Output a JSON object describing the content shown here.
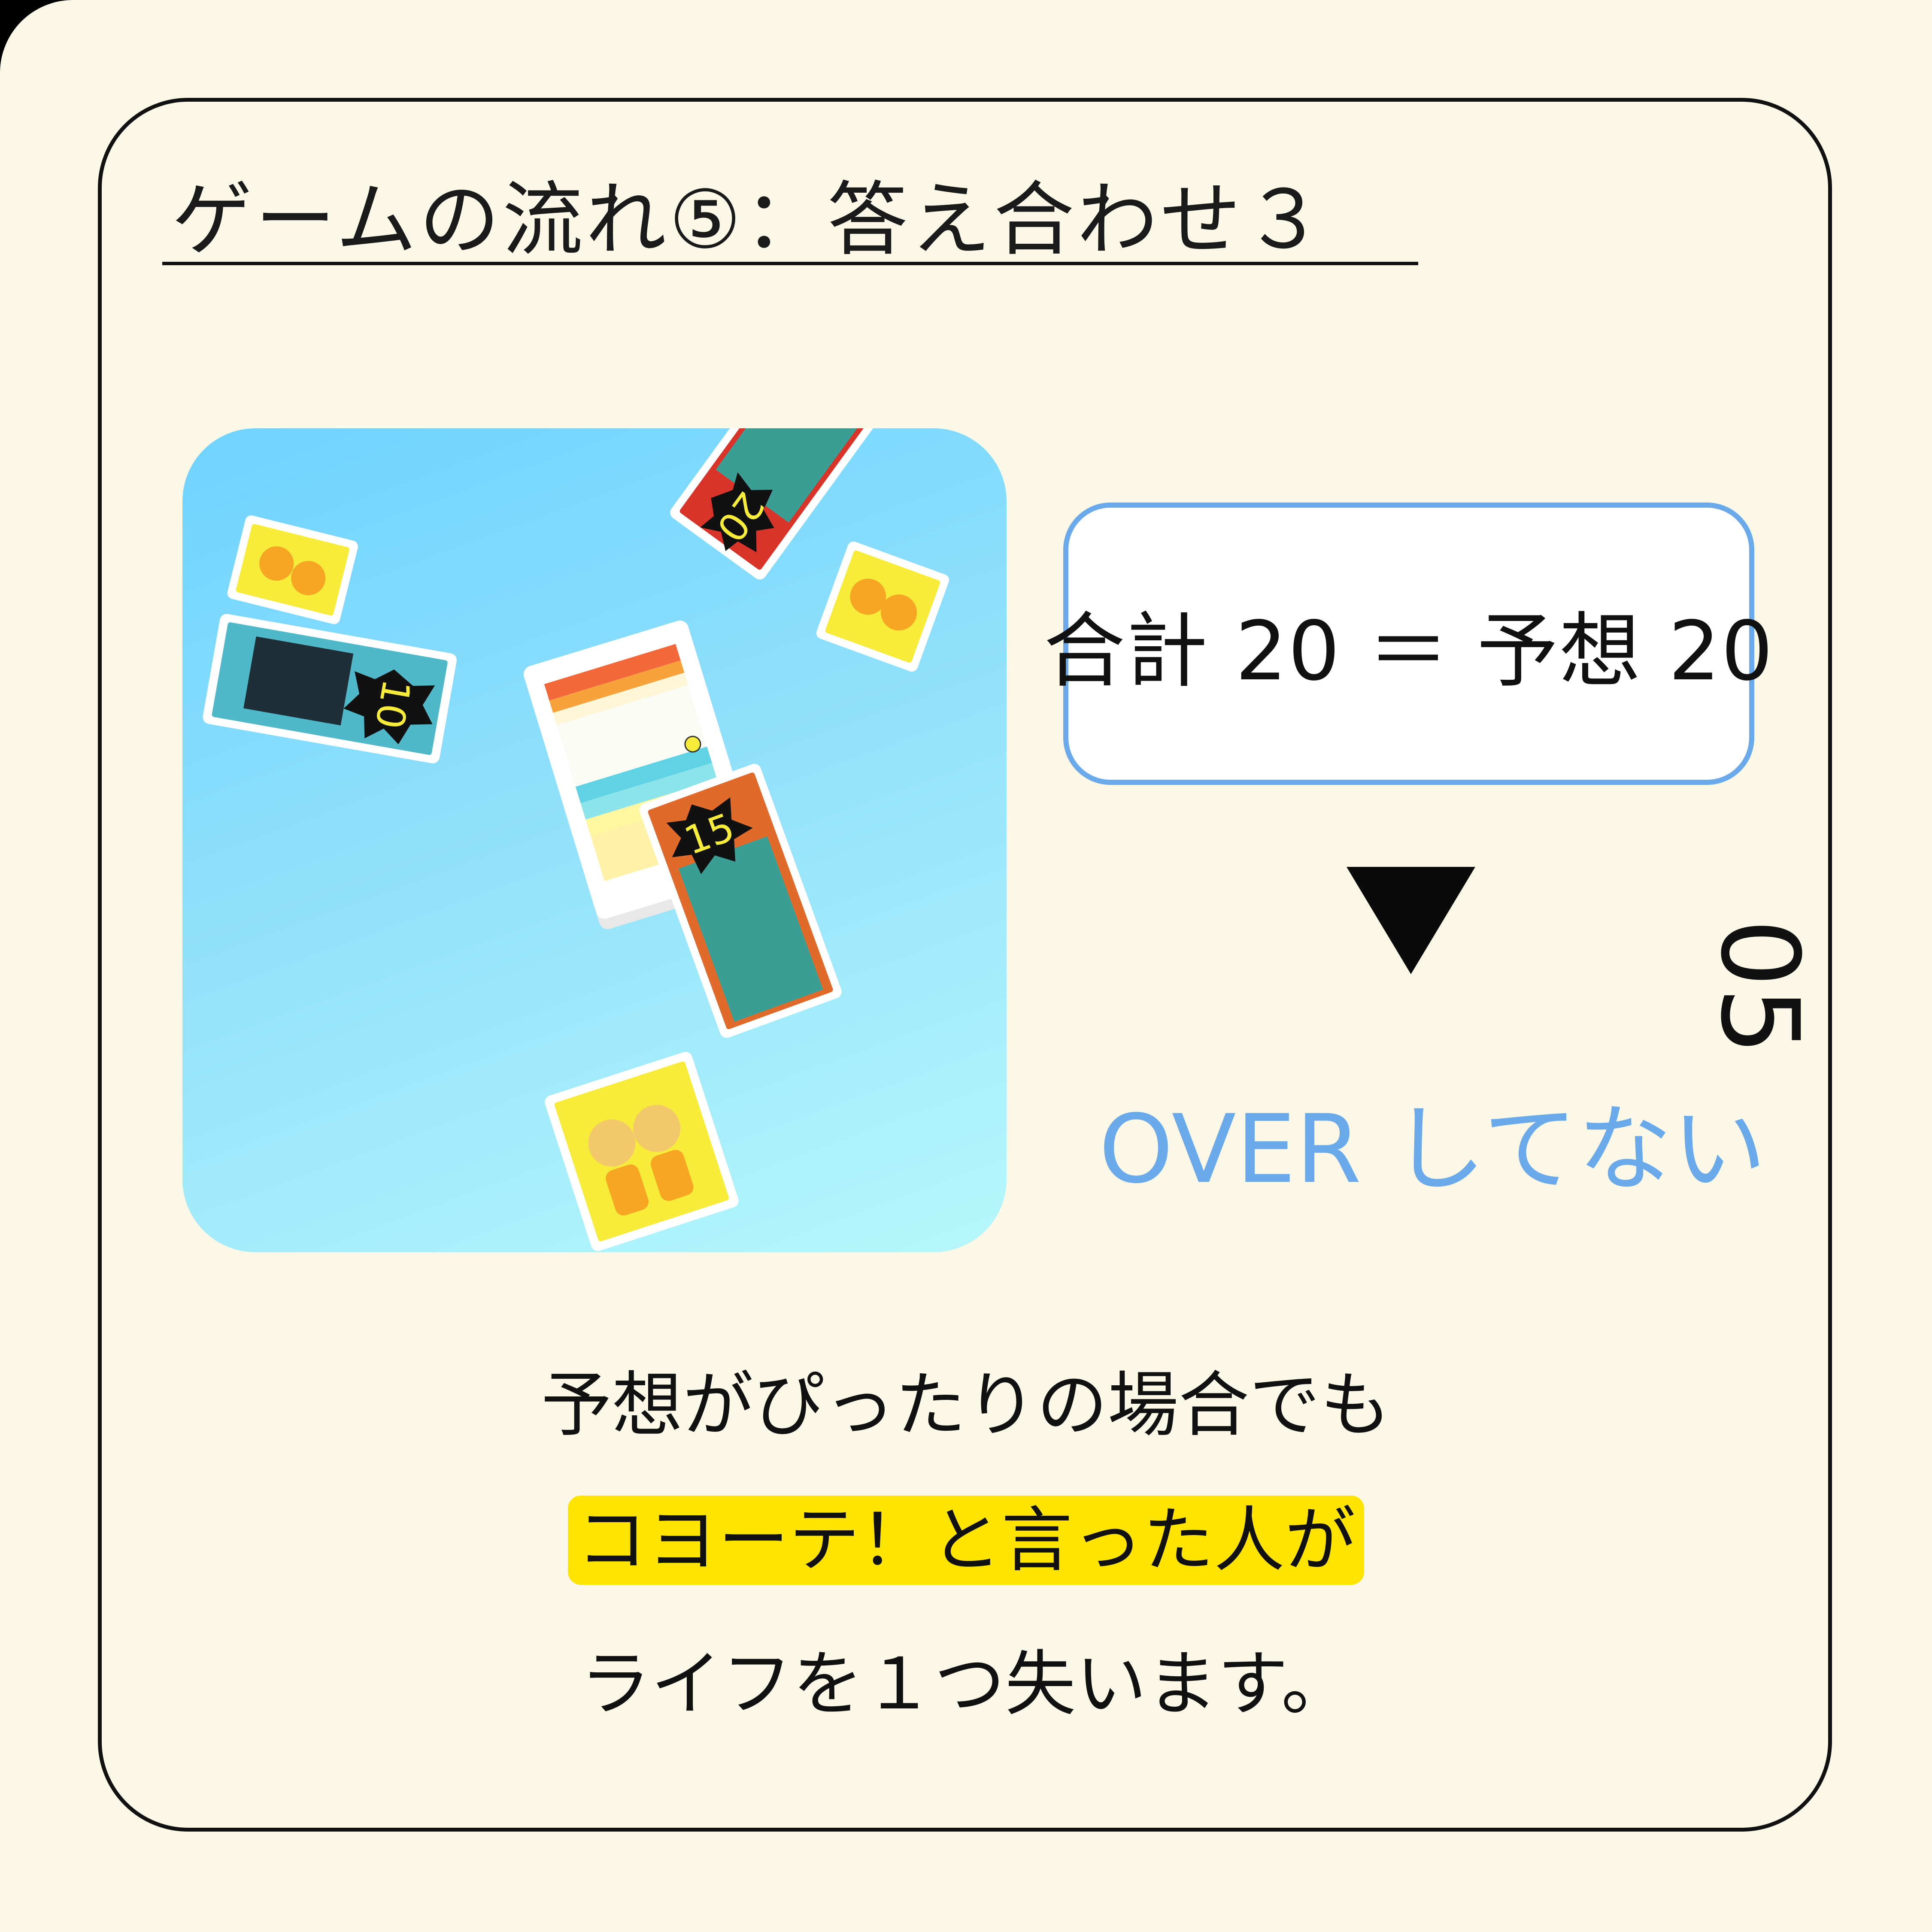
{
  "title": "ゲームの流れ⑤：答え合わせ３",
  "photo": {
    "alt": "",
    "cards": [
      {
        "kind": "number",
        "value": "10",
        "color": "#4fb8c9"
      },
      {
        "kind": "number",
        "value": "20",
        "color": "#d9342a"
      },
      {
        "kind": "number",
        "value": "15",
        "color": "#e06a2a"
      },
      {
        "kind": "coyote",
        "color": "#f7ec3a"
      },
      {
        "kind": "coyote",
        "color": "#f7ec3a"
      },
      {
        "kind": "coyote",
        "color": "#f7ec3a"
      }
    ]
  },
  "equation": {
    "text": "合計 20 ＝ 予想 20"
  },
  "status_text": "OVER してない",
  "page_number": "05",
  "body": {
    "line1": "予想がぴったりの場合でも",
    "line2": "コヨーテ！と言った人が",
    "line3": "ライフを１つ失います。"
  },
  "colors": {
    "background": "#fbf8e8",
    "accent": "#6aa9ea",
    "highlight": "#ffe400",
    "frame": "#111111"
  }
}
